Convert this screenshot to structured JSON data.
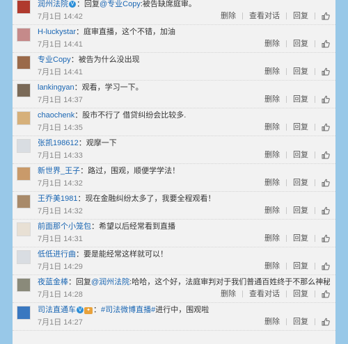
{
  "actions": {
    "delete": "删除",
    "view_conversation": "查看对话",
    "reply": "回复"
  },
  "comments": [
    {
      "user": "润州法院",
      "parts": [
        {
          "t": "verified"
        },
        {
          "t": "sep",
          "v": "："
        },
        {
          "t": "text",
          "v": "回复"
        },
        {
          "t": "mention",
          "v": "@专业Copy"
        },
        {
          "t": "text",
          "v": ":被告缺席庭审。"
        }
      ],
      "time": "7月1日 14:42",
      "has_view_conversation": true,
      "avatar_color": "#b03a2e"
    },
    {
      "user": "H-luckystar",
      "parts": [
        {
          "t": "sep",
          "v": "："
        },
        {
          "t": "text",
          "v": "庭审直播，这个不错，加油"
        }
      ],
      "time": "7月1日 14:41",
      "has_view_conversation": false,
      "avatar_color": "#c58a8a"
    },
    {
      "user": "专业Copy",
      "parts": [
        {
          "t": "sep",
          "v": "："
        },
        {
          "t": "text",
          "v": "被告为什么没出现"
        }
      ],
      "time": "7月1日 14:41",
      "has_view_conversation": false,
      "avatar_color": "#9a6a4a"
    },
    {
      "user": "lankingyan",
      "parts": [
        {
          "t": "sep",
          "v": "："
        },
        {
          "t": "text",
          "v": "观看，学习一下。"
        }
      ],
      "time": "7月1日 14:37",
      "has_view_conversation": false,
      "avatar_color": "#7a6a58"
    },
    {
      "user": "chaochenk",
      "parts": [
        {
          "t": "sep",
          "v": "："
        },
        {
          "t": "text",
          "v": "股市不行了 借贷纠纷会比较多."
        }
      ],
      "time": "7月1日 14:35",
      "has_view_conversation": false,
      "avatar_color": "#d6b07a"
    },
    {
      "user": "张凯198612",
      "parts": [
        {
          "t": "sep",
          "v": "："
        },
        {
          "t": "text",
          "v": "观摩一下"
        }
      ],
      "time": "7月1日 14:33",
      "has_view_conversation": false,
      "avatar_color": "#d9dde2"
    },
    {
      "user": "新世界_王子",
      "parts": [
        {
          "t": "sep",
          "v": "："
        },
        {
          "t": "text",
          "v": "路过，围观，顺便学学法！"
        }
      ],
      "time": "7月1日 14:32",
      "has_view_conversation": false,
      "avatar_color": "#c99a6a"
    },
    {
      "user": "王乔美1981",
      "parts": [
        {
          "t": "sep",
          "v": "："
        },
        {
          "t": "text",
          "v": "现在金融纠纷太多了，我要全程观看！"
        }
      ],
      "time": "7月1日 14:32",
      "has_view_conversation": false,
      "avatar_color": "#a88a6a"
    },
    {
      "user": "前面那个小笼包",
      "parts": [
        {
          "t": "sep",
          "v": "："
        },
        {
          "t": "text",
          "v": "希望以后经常看到直播"
        }
      ],
      "time": "7月1日 14:31",
      "has_view_conversation": false,
      "avatar_color": "#e8e0d4"
    },
    {
      "user": "低低进行曲",
      "parts": [
        {
          "t": "sep",
          "v": "："
        },
        {
          "t": "text",
          "v": "要是能经常这样就可以！"
        }
      ],
      "time": "7月1日 14:29",
      "has_view_conversation": false,
      "avatar_color": "#d9dde2"
    },
    {
      "user": "夜蓝金棒",
      "parts": [
        {
          "t": "sep",
          "v": "："
        },
        {
          "t": "text",
          "v": "回复"
        },
        {
          "t": "mention",
          "v": "@润州法院"
        },
        {
          "t": "text",
          "v": ":哈哈，这个好，法庭审判对于我们普通百姓终于不那么神秘了"
        }
      ],
      "time": "7月1日 14:28",
      "has_view_conversation": true,
      "avatar_color": "#8a8a7a"
    },
    {
      "user": "司法直通车",
      "parts": [
        {
          "t": "verified"
        },
        {
          "t": "rbadge"
        },
        {
          "t": "sep",
          "v": "："
        },
        {
          "t": "mention",
          "v": "#司法微博直播#"
        },
        {
          "t": "text",
          "v": "进行中，围观啦"
        }
      ],
      "time": "7月1日 14:27",
      "has_view_conversation": false,
      "avatar_color": "#3a78c0"
    }
  ]
}
